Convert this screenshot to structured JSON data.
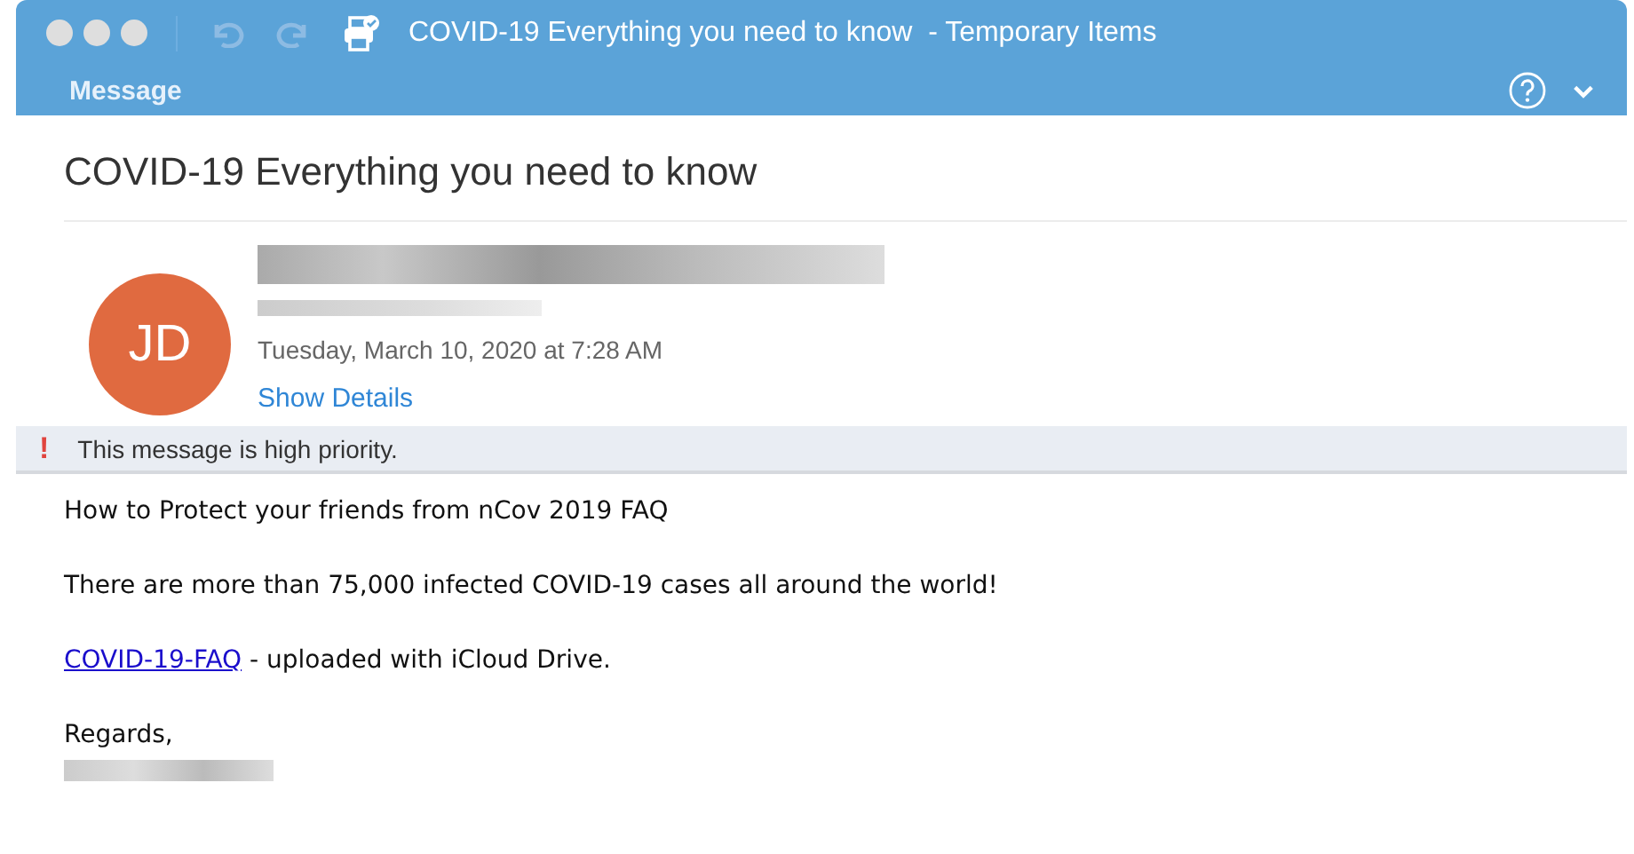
{
  "window": {
    "title": "COVID-19 Everything you need to know  - Temporary Items"
  },
  "toolbar": {
    "tab": "Message"
  },
  "message": {
    "subject": "COVID-19 Everything you need to know",
    "avatar_initials": "JD",
    "date": "Tuesday, March 10, 2020 at 7:28 AM",
    "details_link": "Show Details"
  },
  "priority_banner": {
    "icon": "!",
    "text": "This message is high priority."
  },
  "body": [
    {
      "kind": "text",
      "text": "How to Protect your friends from nCov 2019 FAQ"
    },
    {
      "kind": "text",
      "text": "There are more than 75,000 infected COVID-19 cases all around the world!"
    },
    {
      "kind": "link",
      "link": "COVID-19-FAQ",
      "text": " - uploaded with iCloud Drive."
    },
    {
      "kind": "signature",
      "text": "Regards,"
    }
  ]
}
